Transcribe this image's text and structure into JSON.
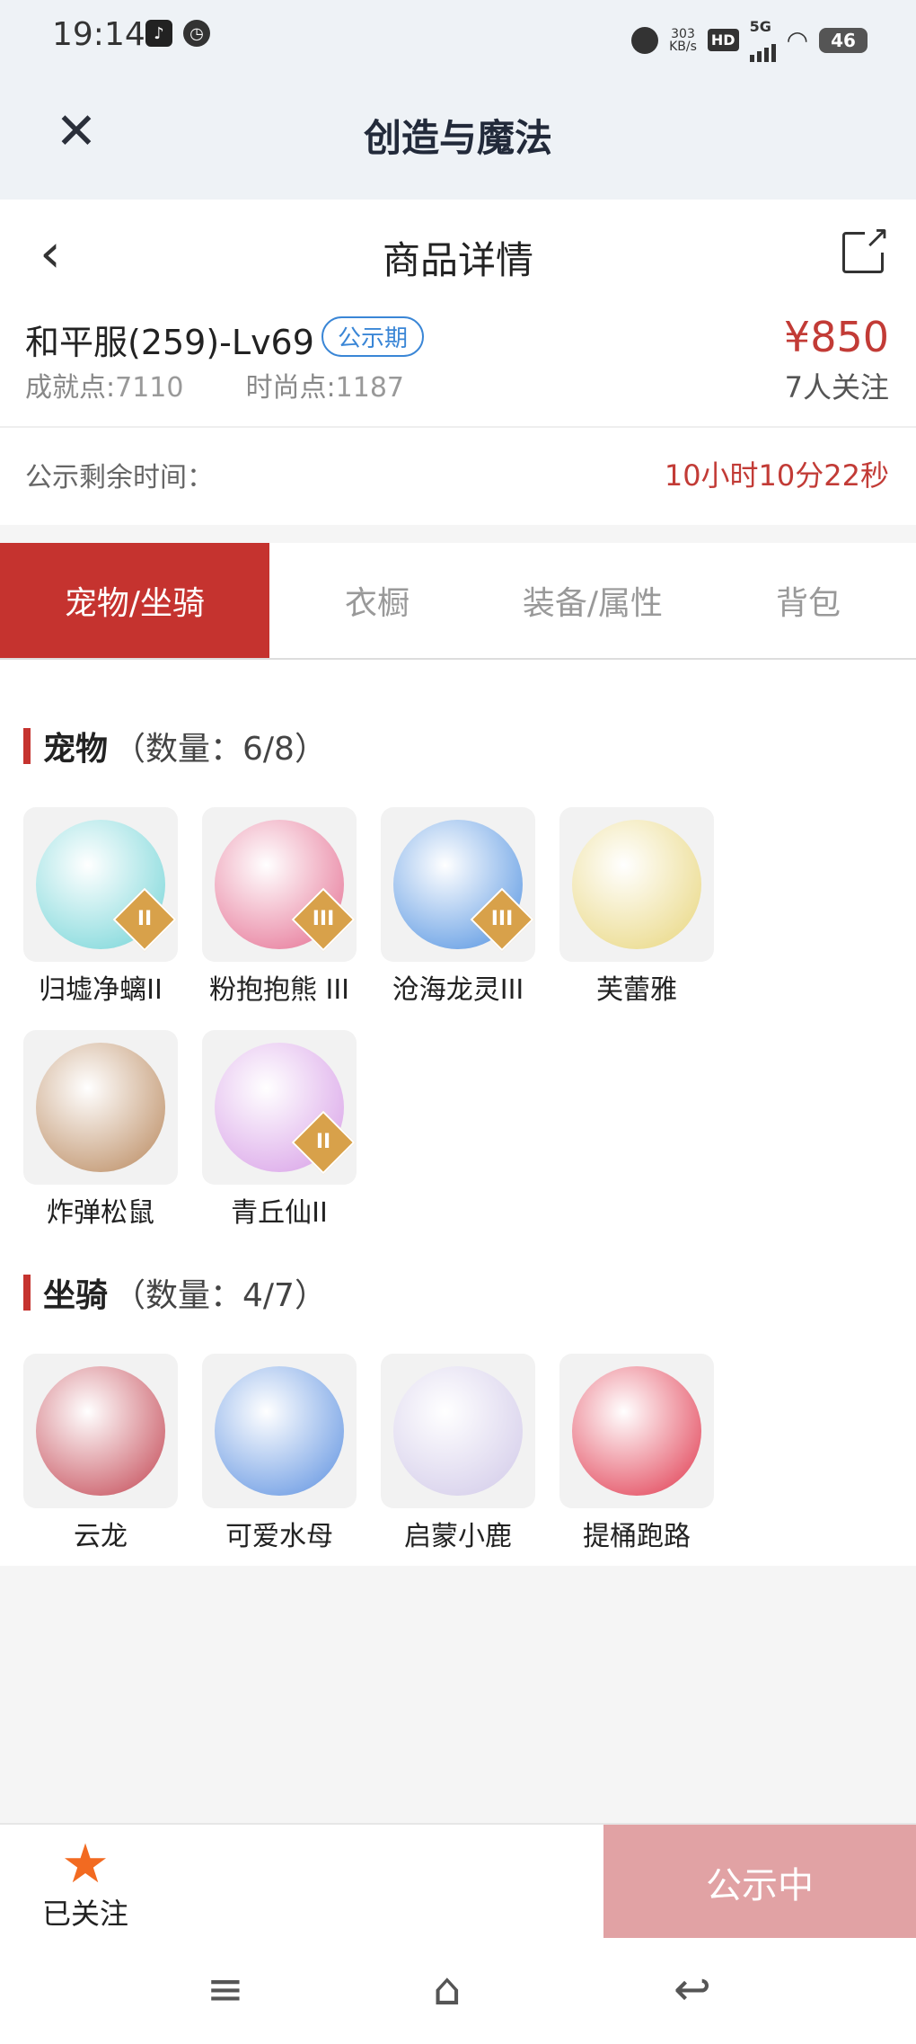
{
  "status_bar": {
    "time": "19:14",
    "network_speed_value": "303",
    "network_speed_unit": "KB/s",
    "hd": "HD",
    "network": "5G",
    "battery": "46"
  },
  "app": {
    "title": "创造与魔法"
  },
  "header": {
    "title": "商品详情"
  },
  "product": {
    "server": "和平服(259)-Lv69",
    "status_tag": "公示期",
    "price": "¥850",
    "achievement_label": "成就点:",
    "achievement_value": "7110",
    "fashion_label": "时尚点:",
    "fashion_value": "1187",
    "followers": "7人关注"
  },
  "countdown": {
    "label": "公示剩余时间：",
    "value": "10小时10分22秒"
  },
  "tabs": [
    {
      "label": "宠物/坐骑",
      "active": true
    },
    {
      "label": "衣橱"
    },
    {
      "label": "装备/属性"
    },
    {
      "label": "背包"
    }
  ],
  "pets": {
    "title": "宠物",
    "count": "（数量：6/8）",
    "items": [
      {
        "name": "归墟净螭II",
        "badge": "II",
        "color": "#6fd3d6"
      },
      {
        "name": "粉抱抱熊 III",
        "badge": "III",
        "color": "#e46a8e"
      },
      {
        "name": "沧海龙灵III",
        "badge": "III",
        "color": "#4d8fe0"
      },
      {
        "name": "芙蕾雅",
        "badge": "",
        "color": "#e8d57a"
      },
      {
        "name": "炸弹松鼠",
        "badge": "",
        "color": "#b8865a"
      },
      {
        "name": "青丘仙II",
        "badge": "II",
        "color": "#d69be6"
      }
    ]
  },
  "mounts": {
    "title": "坐骑",
    "count": "（数量：4/7）",
    "items": [
      {
        "name": "云龙",
        "color": "#c2424f"
      },
      {
        "name": "可爱水母",
        "color": "#5a8fe0"
      },
      {
        "name": "启蒙小鹿",
        "color": "#d0c8e8"
      },
      {
        "name": "提桶跑路",
        "color": "#e0344a"
      }
    ]
  },
  "bottom": {
    "follow_label": "已关注",
    "status_button": "公示中"
  }
}
